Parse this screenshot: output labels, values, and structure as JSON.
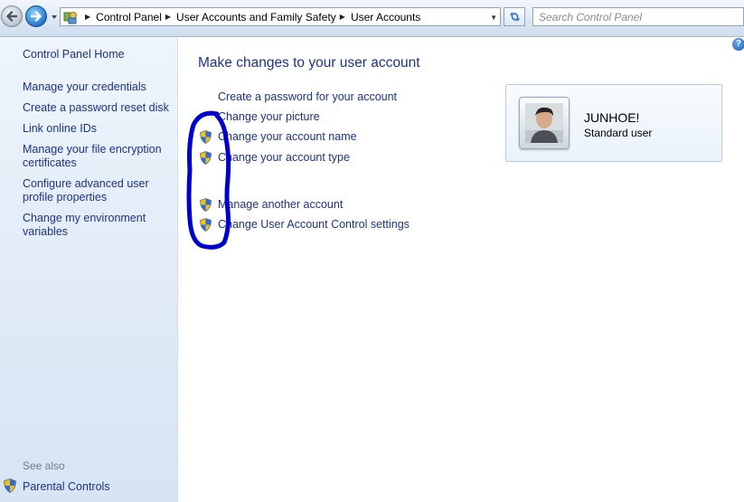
{
  "address_bar": {
    "breadcrumbs": [
      "Control Panel",
      "User Accounts and Family Safety",
      "User Accounts"
    ],
    "search_placeholder": "Search Control Panel"
  },
  "sidebar": {
    "home_link": "Control Panel Home",
    "links": [
      "Manage your credentials",
      "Create a password reset disk",
      "Link online IDs",
      "Manage your file encryption certificates",
      "Configure advanced user profile properties",
      "Change my environment variables"
    ],
    "see_also_label": "See also",
    "see_also_links": [
      "Parental Controls"
    ]
  },
  "main": {
    "title": "Make changes to your user account",
    "tasks": [
      {
        "label": "Create a password for your account",
        "shield": false
      },
      {
        "label": "Change your picture",
        "shield": false
      },
      {
        "label": "Change your account name",
        "shield": true
      },
      {
        "label": "Change your account type",
        "shield": true
      },
      {
        "label": "Manage another account",
        "shield": true
      },
      {
        "label": "Change User Account Control settings",
        "shield": true
      }
    ]
  },
  "user_card": {
    "name": "JUNHOE!",
    "type": "Standard user"
  },
  "help_icon_glyph": "?",
  "colors": {
    "link": "#1e3287",
    "annotation": "#0000cc",
    "sidebar_bg": "#dfeaf6"
  },
  "icons": [
    "back-arrow-icon",
    "forward-arrow-icon",
    "control-panel-icon",
    "refresh-icon",
    "uac-shield-icon",
    "help-icon"
  ]
}
